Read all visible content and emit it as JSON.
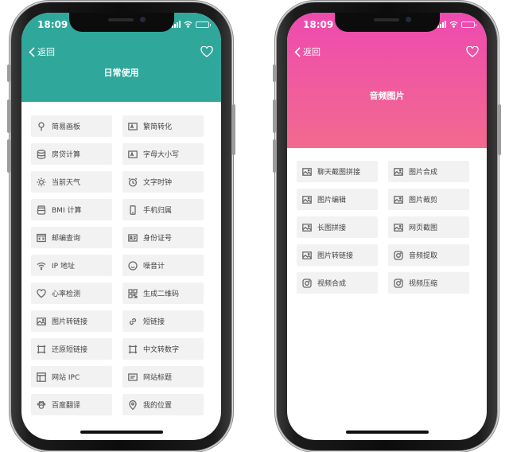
{
  "phones": [
    {
      "time": "18:09",
      "back_label": "返回",
      "title": "日常使用",
      "header_color": "#2fa89b",
      "tools": [
        {
          "label": "简易画板",
          "icon": "pin-icon"
        },
        {
          "label": "繁简转化",
          "icon": "text-box-icon"
        },
        {
          "label": "房贷计算",
          "icon": "database-icon"
        },
        {
          "label": "字母大小写",
          "icon": "text-box-icon"
        },
        {
          "label": "当前天气",
          "icon": "sun-icon"
        },
        {
          "label": "文字时钟",
          "icon": "alarm-clock-icon"
        },
        {
          "label": "BMI 计算",
          "icon": "jar-icon"
        },
        {
          "label": "手机归属",
          "icon": "phone-icon"
        },
        {
          "label": "邮编查询",
          "icon": "code-window-icon"
        },
        {
          "label": "身份证号",
          "icon": "id-card-icon"
        },
        {
          "label": "IP 地址",
          "icon": "wifi-icon"
        },
        {
          "label": "噪音计",
          "icon": "smiley-icon"
        },
        {
          "label": "心率检测",
          "icon": "heart-icon"
        },
        {
          "label": "生成二维码",
          "icon": "qr-code-icon"
        },
        {
          "label": "图片转链接",
          "icon": "image-icon"
        },
        {
          "label": "短链接",
          "icon": "link-icon"
        },
        {
          "label": "还原短链接",
          "icon": "expand-icon"
        },
        {
          "label": "中文转数字",
          "icon": "expand-icon"
        },
        {
          "label": "网站 IPC",
          "icon": "layout-icon"
        },
        {
          "label": "网站标题",
          "icon": "title-bar-icon"
        },
        {
          "label": "百度翻译",
          "icon": "paw-icon"
        },
        {
          "label": "我的位置",
          "icon": "location-pin-icon"
        }
      ]
    },
    {
      "time": "18:09",
      "back_label": "返回",
      "title": "音频图片",
      "header_gradient": [
        "#ee4ab0",
        "#f26a8e"
      ],
      "tools": [
        {
          "label": "聊天截图拼接",
          "icon": "image-icon"
        },
        {
          "label": "图片合成",
          "icon": "image-icon"
        },
        {
          "label": "图片编辑",
          "icon": "image-icon"
        },
        {
          "label": "图片裁剪",
          "icon": "image-icon"
        },
        {
          "label": "长图拼接",
          "icon": "image-icon"
        },
        {
          "label": "网页截图",
          "icon": "image-icon"
        },
        {
          "label": "图片转链接",
          "icon": "image-icon"
        },
        {
          "label": "音频提取",
          "icon": "camera-icon"
        },
        {
          "label": "视频合成",
          "icon": "camera-icon"
        },
        {
          "label": "视频压缩",
          "icon": "camera-icon"
        }
      ]
    }
  ]
}
